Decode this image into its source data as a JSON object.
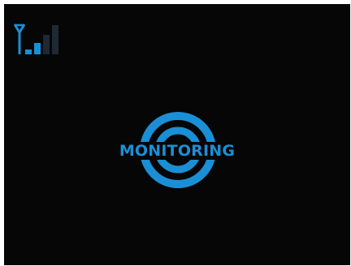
{
  "screen": {
    "background_color": "#050605",
    "accent_color": "#1a8fd6",
    "inactive_color": "#1e2a33"
  },
  "signal_indicator": {
    "icon": "cellular-signal-icon",
    "bars_total": 4,
    "bars_active": 2
  },
  "status": {
    "icon": "target-icon",
    "label": "MONITORING"
  }
}
